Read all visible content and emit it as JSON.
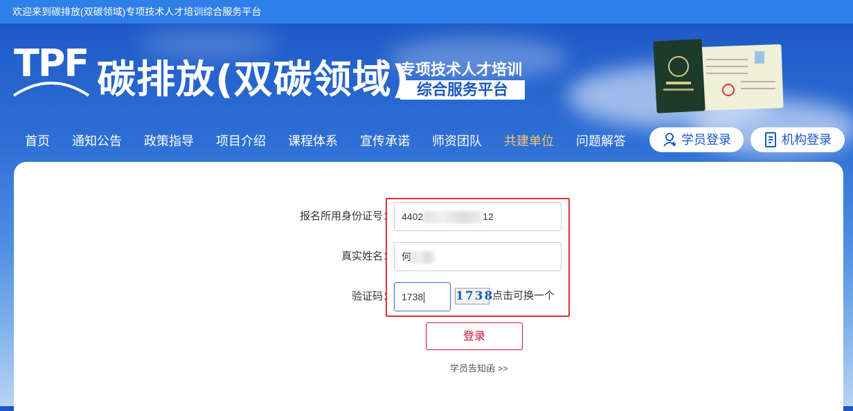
{
  "topbar": {
    "welcome": "欢迎来到碳排放(双碳领域)专项技术人才培训综合服务平台"
  },
  "header": {
    "logo_mark": "TPF",
    "title": "碳排放(双碳领域)",
    "subtitle_line1": "专项技术人才培训",
    "subtitle_line2": "综合服务平台"
  },
  "nav": {
    "items": [
      {
        "label": "首页"
      },
      {
        "label": "通知公告"
      },
      {
        "label": "政策指导"
      },
      {
        "label": "项目介绍"
      },
      {
        "label": "课程体系"
      },
      {
        "label": "宣传承诺"
      },
      {
        "label": "师资团队"
      },
      {
        "label": "共建单位"
      },
      {
        "label": "问题解答"
      }
    ],
    "active_index": 7,
    "student_login": "学员登录",
    "org_login": "机构登录"
  },
  "form": {
    "id_label": "报名所用身份证号：",
    "id_value_prefix": "4402",
    "id_value_suffix": "12",
    "name_label": "真实姓名：",
    "name_value": "何",
    "captcha_label": "验证码：",
    "captcha_value": "1738",
    "captcha_image_text": "1738",
    "captcha_hint": "点击可换一个",
    "submit_label": "登录",
    "notice_link": "学员告知函 >>"
  },
  "colors": {
    "topbar": "#2f7fe8",
    "nav_active": "#f6c86b",
    "submit": "#c8143c",
    "highlight": "#e03030"
  }
}
